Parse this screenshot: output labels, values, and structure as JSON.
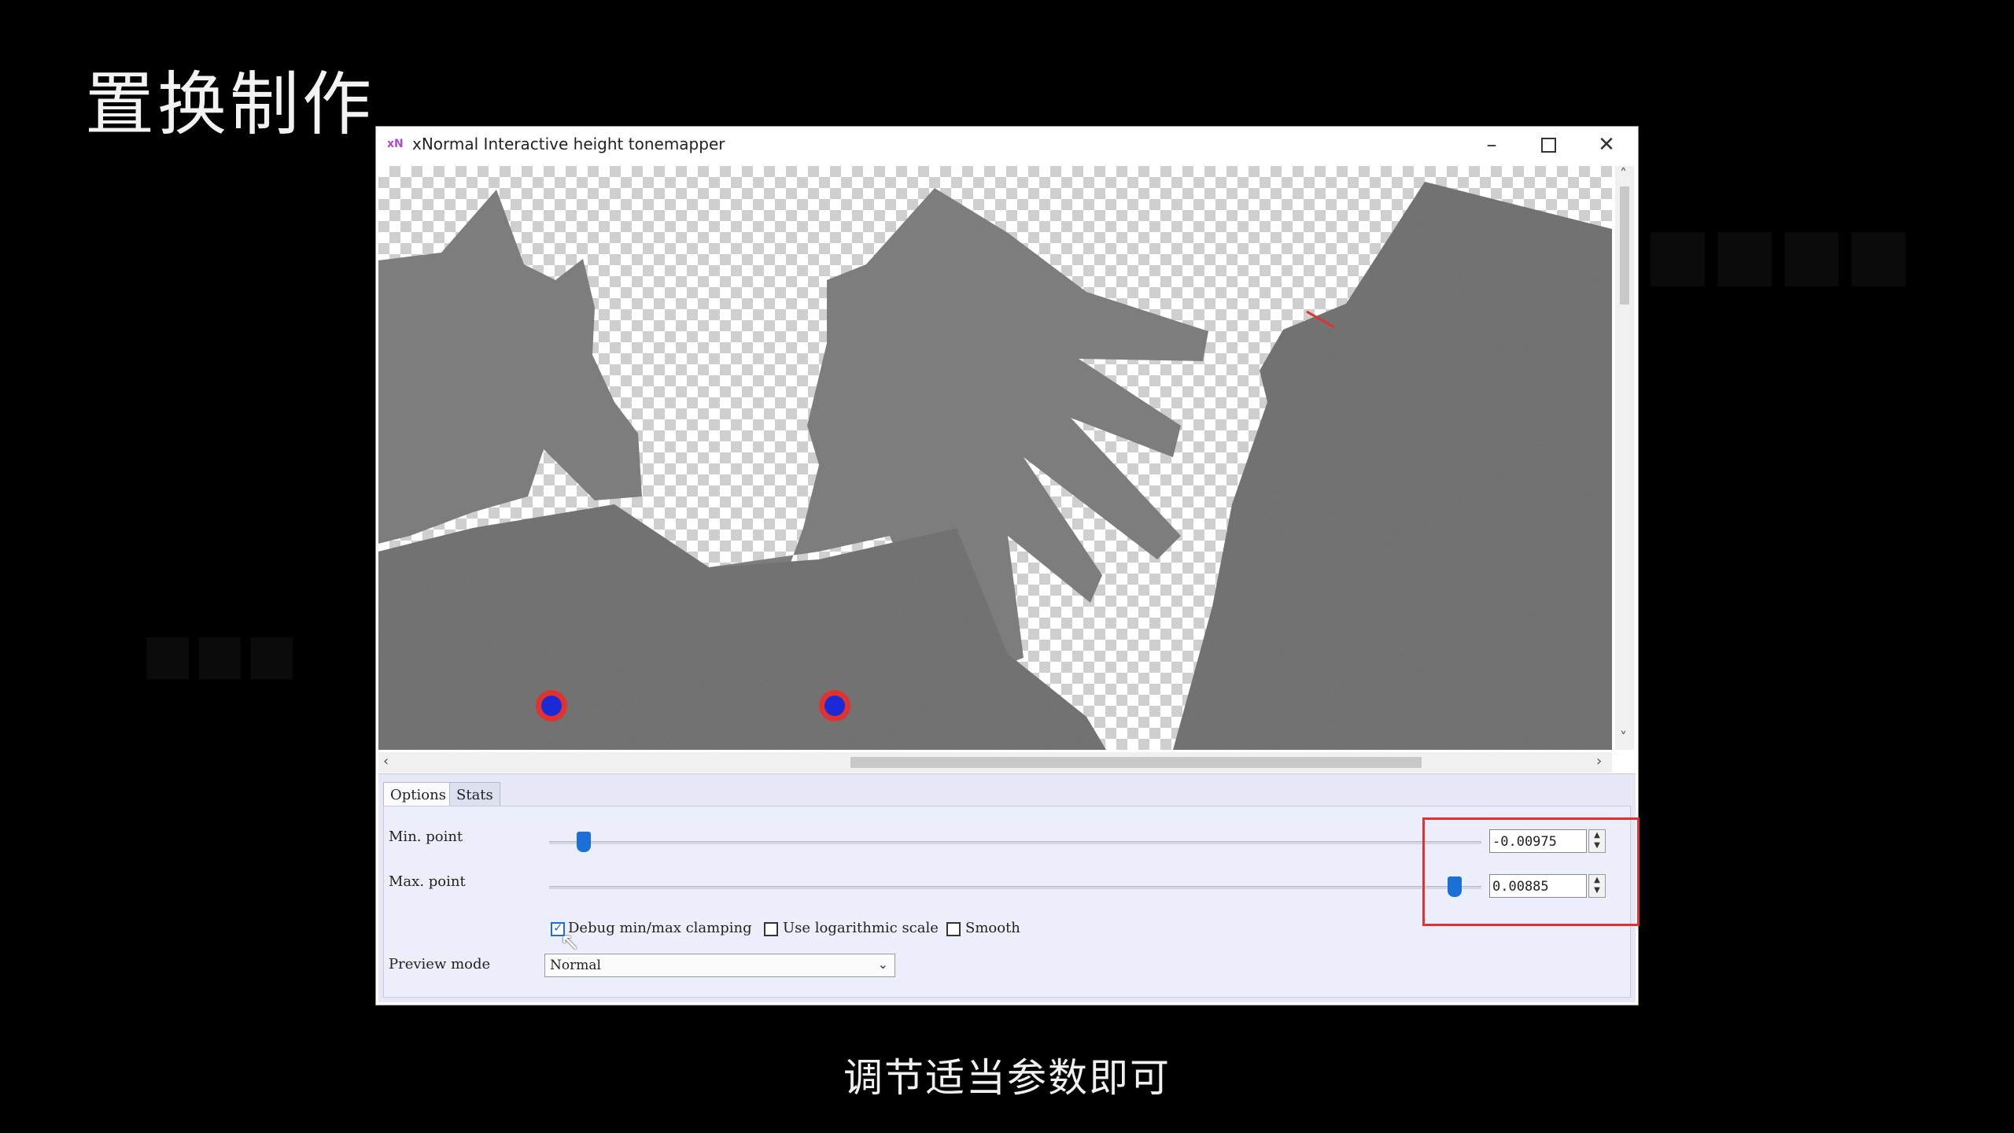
{
  "slide": {
    "title": "置换制作",
    "subtitle": "调节适当参数即可"
  },
  "window": {
    "app_icon": "xN",
    "title": "xNormal Interactive height tonemapper",
    "minimize_icon": "minimize-icon",
    "maximize_icon": "maximize-icon",
    "close_icon": "close-icon"
  },
  "tabs": [
    {
      "label": "Options",
      "active": true
    },
    {
      "label": "Stats",
      "active": false
    }
  ],
  "options": {
    "min_point": {
      "label": "Min. point",
      "value": "-0.00975",
      "slider_fraction": 0.04
    },
    "max_point": {
      "label": "Max. point",
      "value": "0.00885",
      "slider_fraction": 0.96
    },
    "checkboxes": [
      {
        "label": "Debug min/max clamping",
        "checked": true
      },
      {
        "label": "Use logarithmic scale",
        "checked": false
      },
      {
        "label": "Smooth",
        "checked": false
      }
    ],
    "preview_mode": {
      "label": "Preview mode",
      "value": "Normal"
    }
  },
  "colors": {
    "highlight": "#e0322e",
    "slider_thumb": "#1a6fd8",
    "panel_bg": "#e6e8f8",
    "map_gray": "#7a7a7a"
  }
}
